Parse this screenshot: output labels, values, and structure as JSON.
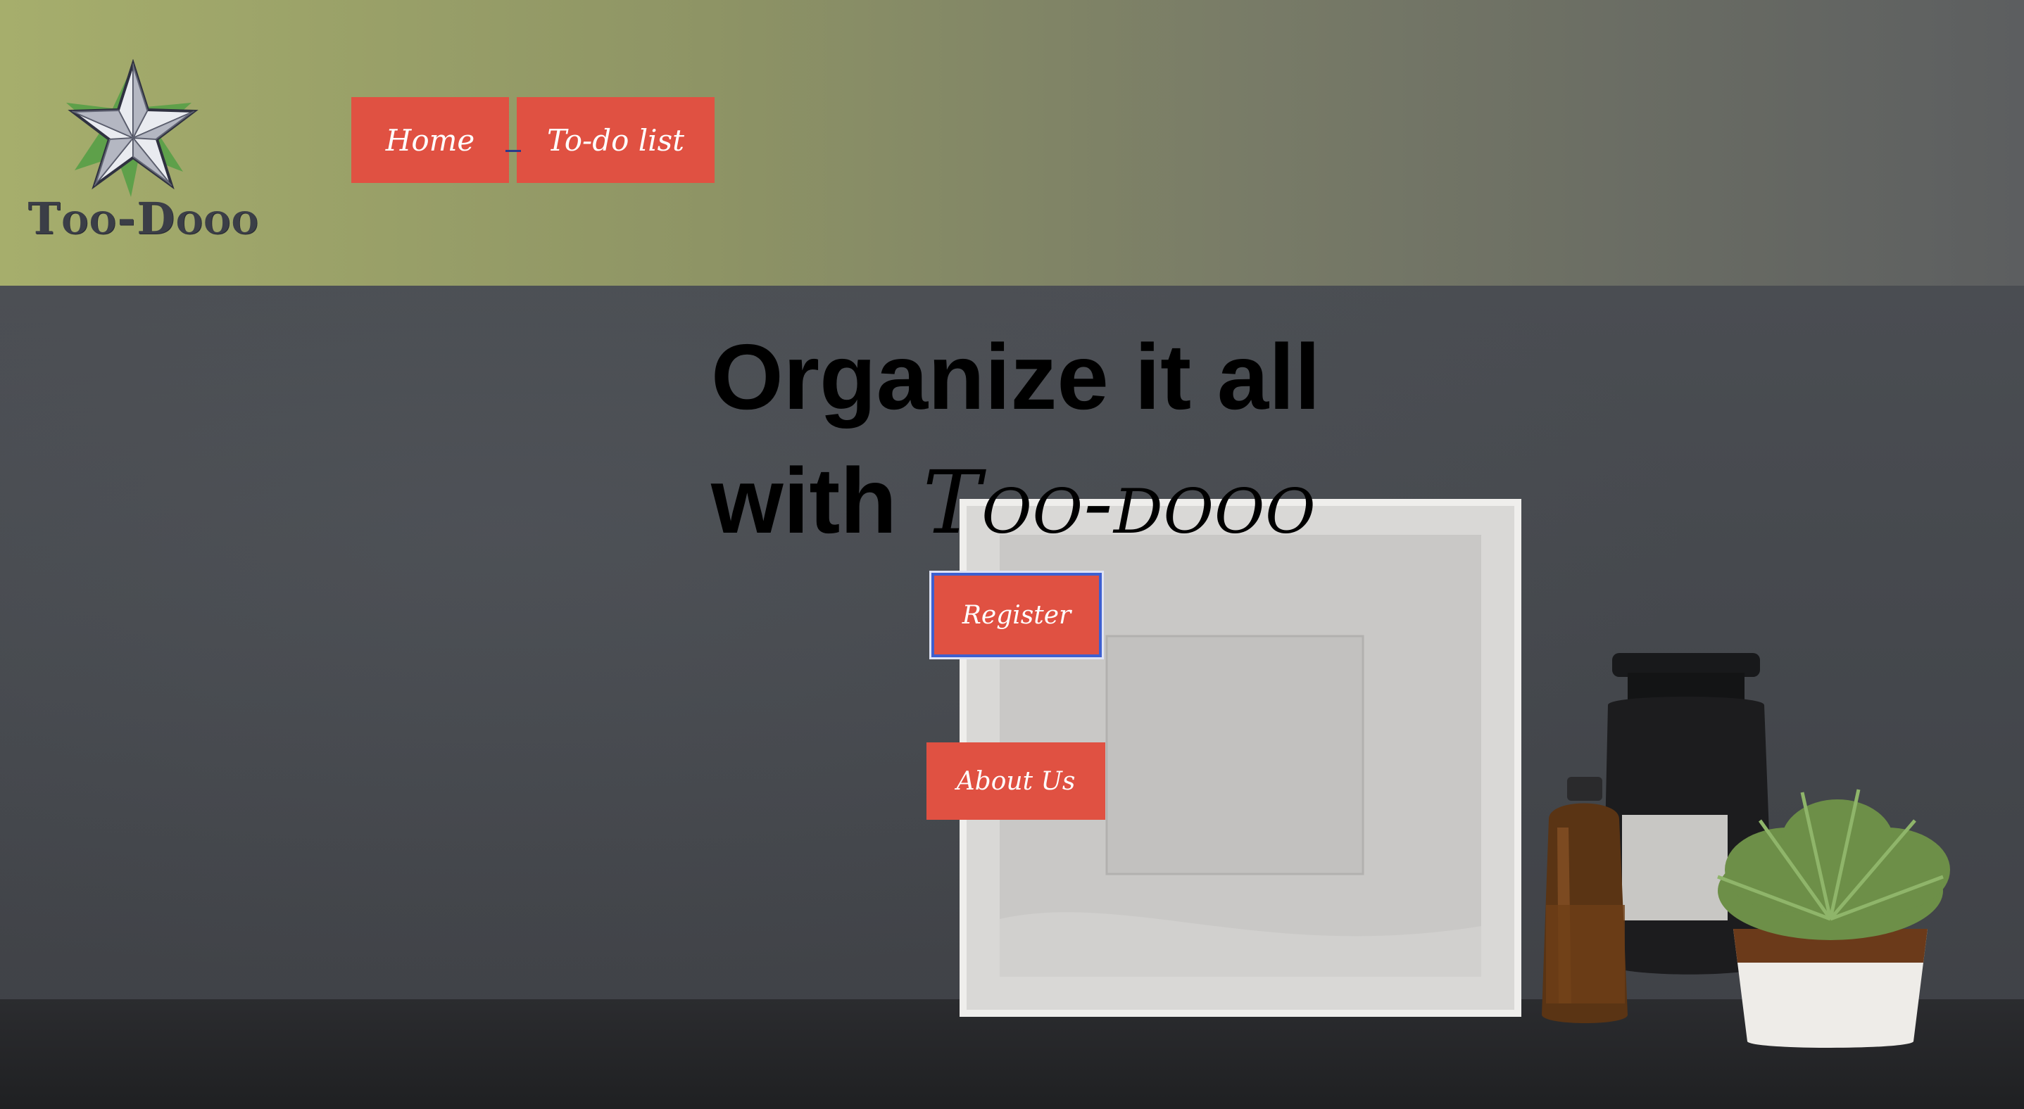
{
  "brand": {
    "logo_text": "Too-Dooo",
    "colors": {
      "header_start": "#a6ae6c",
      "header_end": "#5c5e60",
      "button": "#e05142",
      "button_text": "#ffffff",
      "focus_ring": "#3d5fd0"
    }
  },
  "nav": {
    "items": [
      {
        "label": "Home",
        "icon": ""
      },
      {
        "label": "To-do list",
        "icon": ""
      }
    ]
  },
  "hero": {
    "headline_line1": "Organize it all",
    "headline_with": "with",
    "headline_brand": "Too-dooo",
    "register_label": "Register",
    "about_label": "About Us"
  },
  "icons": {
    "logo": "star-logo-icon"
  }
}
